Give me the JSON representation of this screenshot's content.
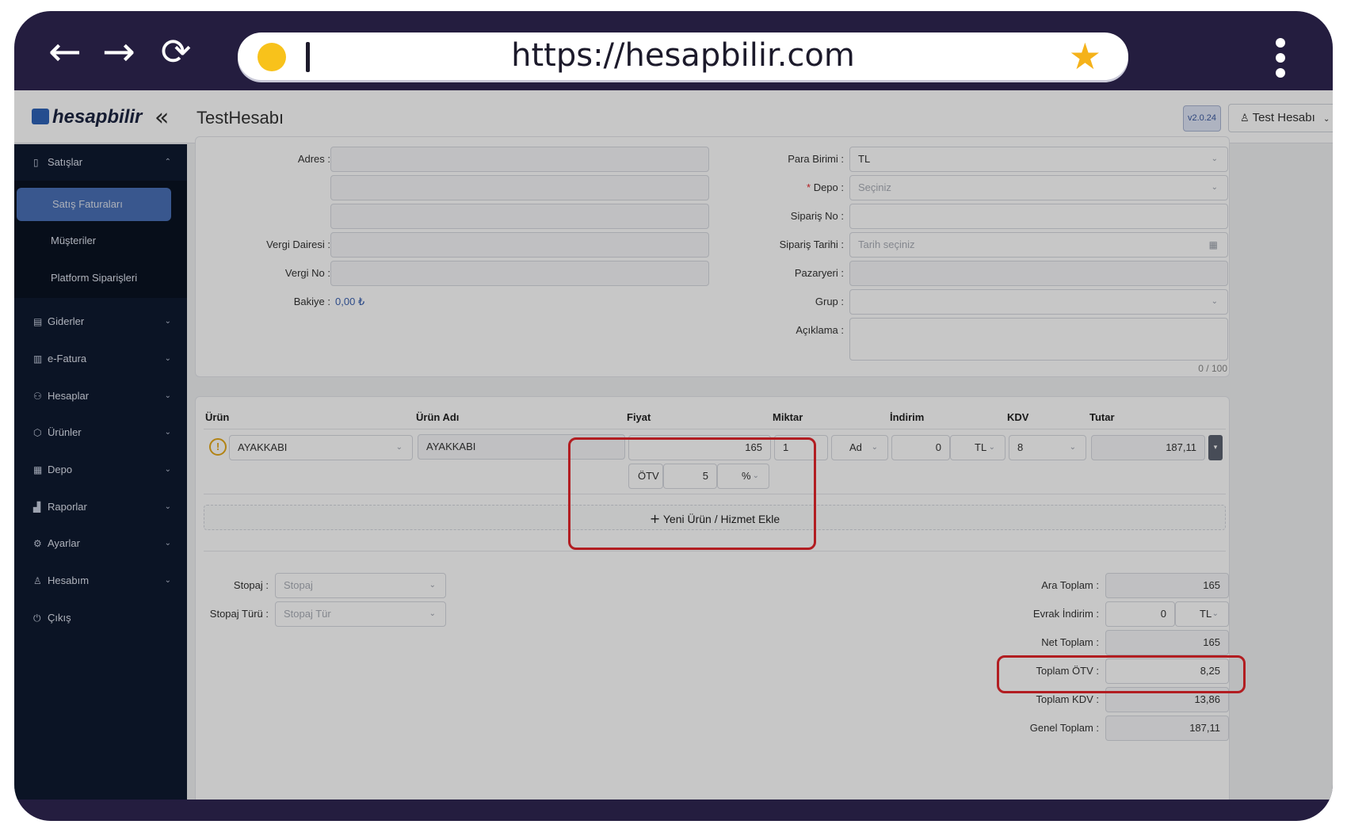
{
  "browser": {
    "back_icon": "←",
    "forward_icon": "→",
    "reload_icon": "⟳",
    "url": "https://hesapbilir.com",
    "star_icon": "★"
  },
  "topbar": {
    "logo": "hesapbilir",
    "collapse_icon": "«",
    "org_name": "TestHesabı",
    "version": "v2.0.24",
    "user": "Test Hesabı"
  },
  "sidebar": {
    "items": [
      {
        "label": "Satışlar",
        "icon": "document-icon"
      },
      {
        "label": "Giderler",
        "icon": "expense-icon"
      },
      {
        "label": "e-Fatura",
        "icon": "invoice-icon"
      },
      {
        "label": "Hesaplar",
        "icon": "accounts-icon"
      },
      {
        "label": "Ürünler",
        "icon": "box-icon"
      },
      {
        "label": "Depo",
        "icon": "warehouse-icon"
      },
      {
        "label": "Raporlar",
        "icon": "chart-icon"
      },
      {
        "label": "Ayarlar",
        "icon": "gear-icon"
      },
      {
        "label": "Hesabım",
        "icon": "user-icon"
      },
      {
        "label": "Çıkış",
        "icon": "logout-icon"
      }
    ],
    "sub_items": [
      {
        "label": "Satış Faturaları"
      },
      {
        "label": "Müşteriler"
      },
      {
        "label": "Platform Siparişleri"
      }
    ]
  },
  "form": {
    "left": {
      "adres_label": "Adres :",
      "vergi_dairesi_label": "Vergi Dairesi :",
      "vergi_no_label": "Vergi No :",
      "bakiye_label": "Bakiye :",
      "bakiye_value": "0,00 ₺"
    },
    "right": {
      "para_birimi_label": "Para Birimi :",
      "para_birimi_value": "TL",
      "depo_label": "Depo :",
      "depo_placeholder": "Seçiniz",
      "siparis_no_label": "Sipariş No :",
      "siparis_tarihi_label": "Sipariş Tarihi :",
      "siparis_tarihi_placeholder": "Tarih seçiniz",
      "pazaryeri_label": "Pazaryeri :",
      "grup_label": "Grup :",
      "aciklama_label": "Açıklama :",
      "char_count": "0 / 100"
    }
  },
  "table": {
    "headers": [
      "Ürün",
      "Ürün Adı",
      "Fiyat",
      "Miktar",
      "İndirim",
      "KDV",
      "Tutar"
    ],
    "row": {
      "urun": "AYAKKABI",
      "urun_adi": "AYAKKABI",
      "fiyat": "165",
      "miktar": "1",
      "birim": "Ad",
      "indirim": "0",
      "indirim_birim": "TL",
      "kdv": "8",
      "tutar": "187,11",
      "otv_label": "ÖTV",
      "otv_value": "5",
      "otv_unit": "%"
    },
    "add_button": "Yeni Ürün / Hizmet Ekle"
  },
  "totals": {
    "stopaj_label": "Stopaj :",
    "stopaj_placeholder": "Stopaj",
    "stopaj_turu_label": "Stopaj Türü :",
    "stopaj_turu_placeholder": "Stopaj Tür",
    "ara_toplam_label": "Ara Toplam :",
    "ara_toplam": "165",
    "evrak_indirim_label": "Evrak İndirim :",
    "evrak_indirim": "0",
    "evrak_indirim_birim": "TL",
    "net_toplam_label": "Net Toplam :",
    "net_toplam": "165",
    "toplam_otv_label": "Toplam ÖTV :",
    "toplam_otv": "8,25",
    "toplam_kdv_label": "Toplam KDV :",
    "toplam_kdv": "13,86",
    "genel_toplam_label": "Genel Toplam :",
    "genel_toplam": "187,11"
  },
  "colors": {
    "frame": "#241d3f",
    "sidebar": "#0f1a30",
    "active": "#4a70b6",
    "highlight": "#e5262b"
  }
}
